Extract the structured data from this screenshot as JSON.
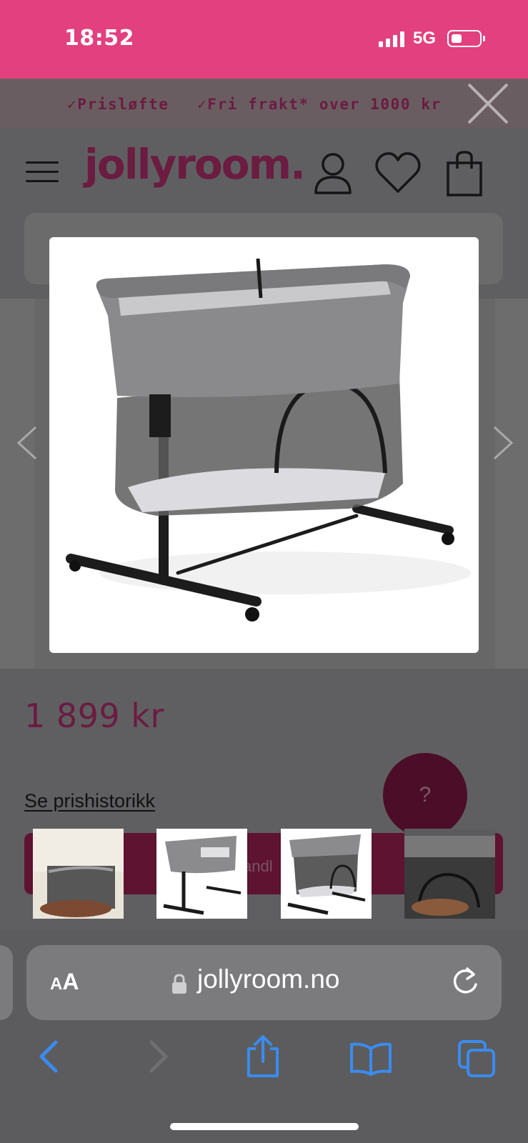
{
  "status_bar": {
    "time": "18:52",
    "network": "5G"
  },
  "promo": {
    "items": [
      "✓Prisløfte",
      "✓Fri frakt* over 1000 kr"
    ]
  },
  "header": {
    "logo": "jollyroom."
  },
  "product": {
    "price": "1 899 kr",
    "price_history_link": "Se prishistorikk",
    "cart_button_partial": "andl",
    "help_button": "?"
  },
  "thumbnails": [
    "thumb-1",
    "thumb-2",
    "thumb-3",
    "thumb-4"
  ],
  "browser": {
    "aa_label_small": "A",
    "aa_label_big": "A",
    "url": "jollyroom.no"
  },
  "colors": {
    "brand": "#6b1c40",
    "status_bar": "#e2407f",
    "safari_blue": "#3a8cf0"
  }
}
